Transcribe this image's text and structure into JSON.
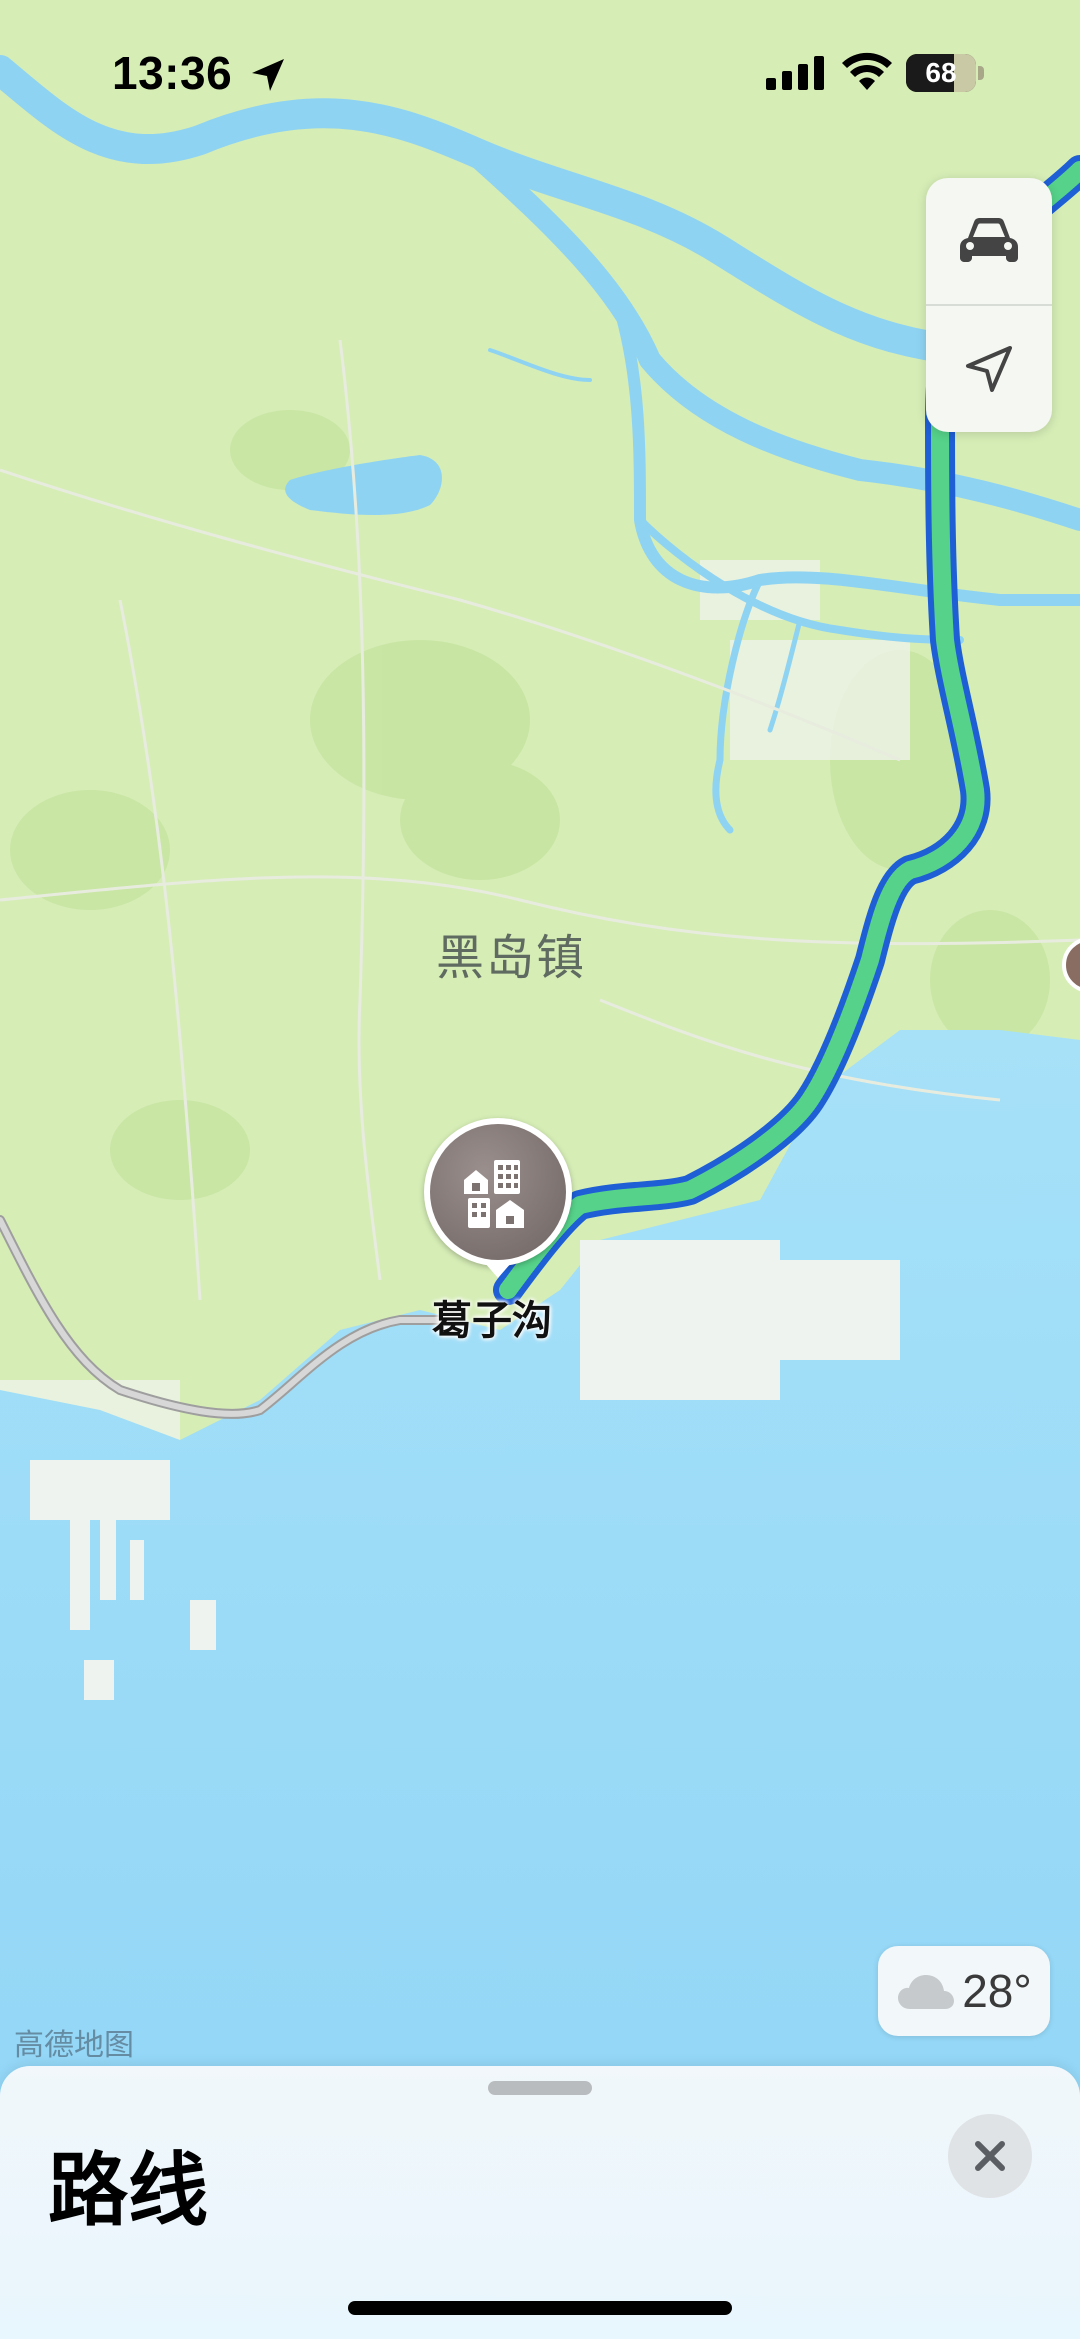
{
  "status_bar": {
    "time": "13:36",
    "battery_level": "68",
    "battery_percent": 68
  },
  "map": {
    "town_label": "黑岛镇",
    "poi_label": "葛子沟",
    "attribution": "高德地图",
    "colors": {
      "land": "#d4ecb4",
      "water": "#9fdcf7",
      "river": "#8fd3f2",
      "route_fill": "#56d28a",
      "route_outline": "#1e5fd6"
    }
  },
  "controls": {
    "drive_icon": "car-icon",
    "locate_icon": "location-arrow-icon"
  },
  "weather": {
    "icon": "cloud-icon",
    "temperature": "28°"
  },
  "sheet": {
    "title": "路线",
    "close_icon": "close-icon"
  }
}
